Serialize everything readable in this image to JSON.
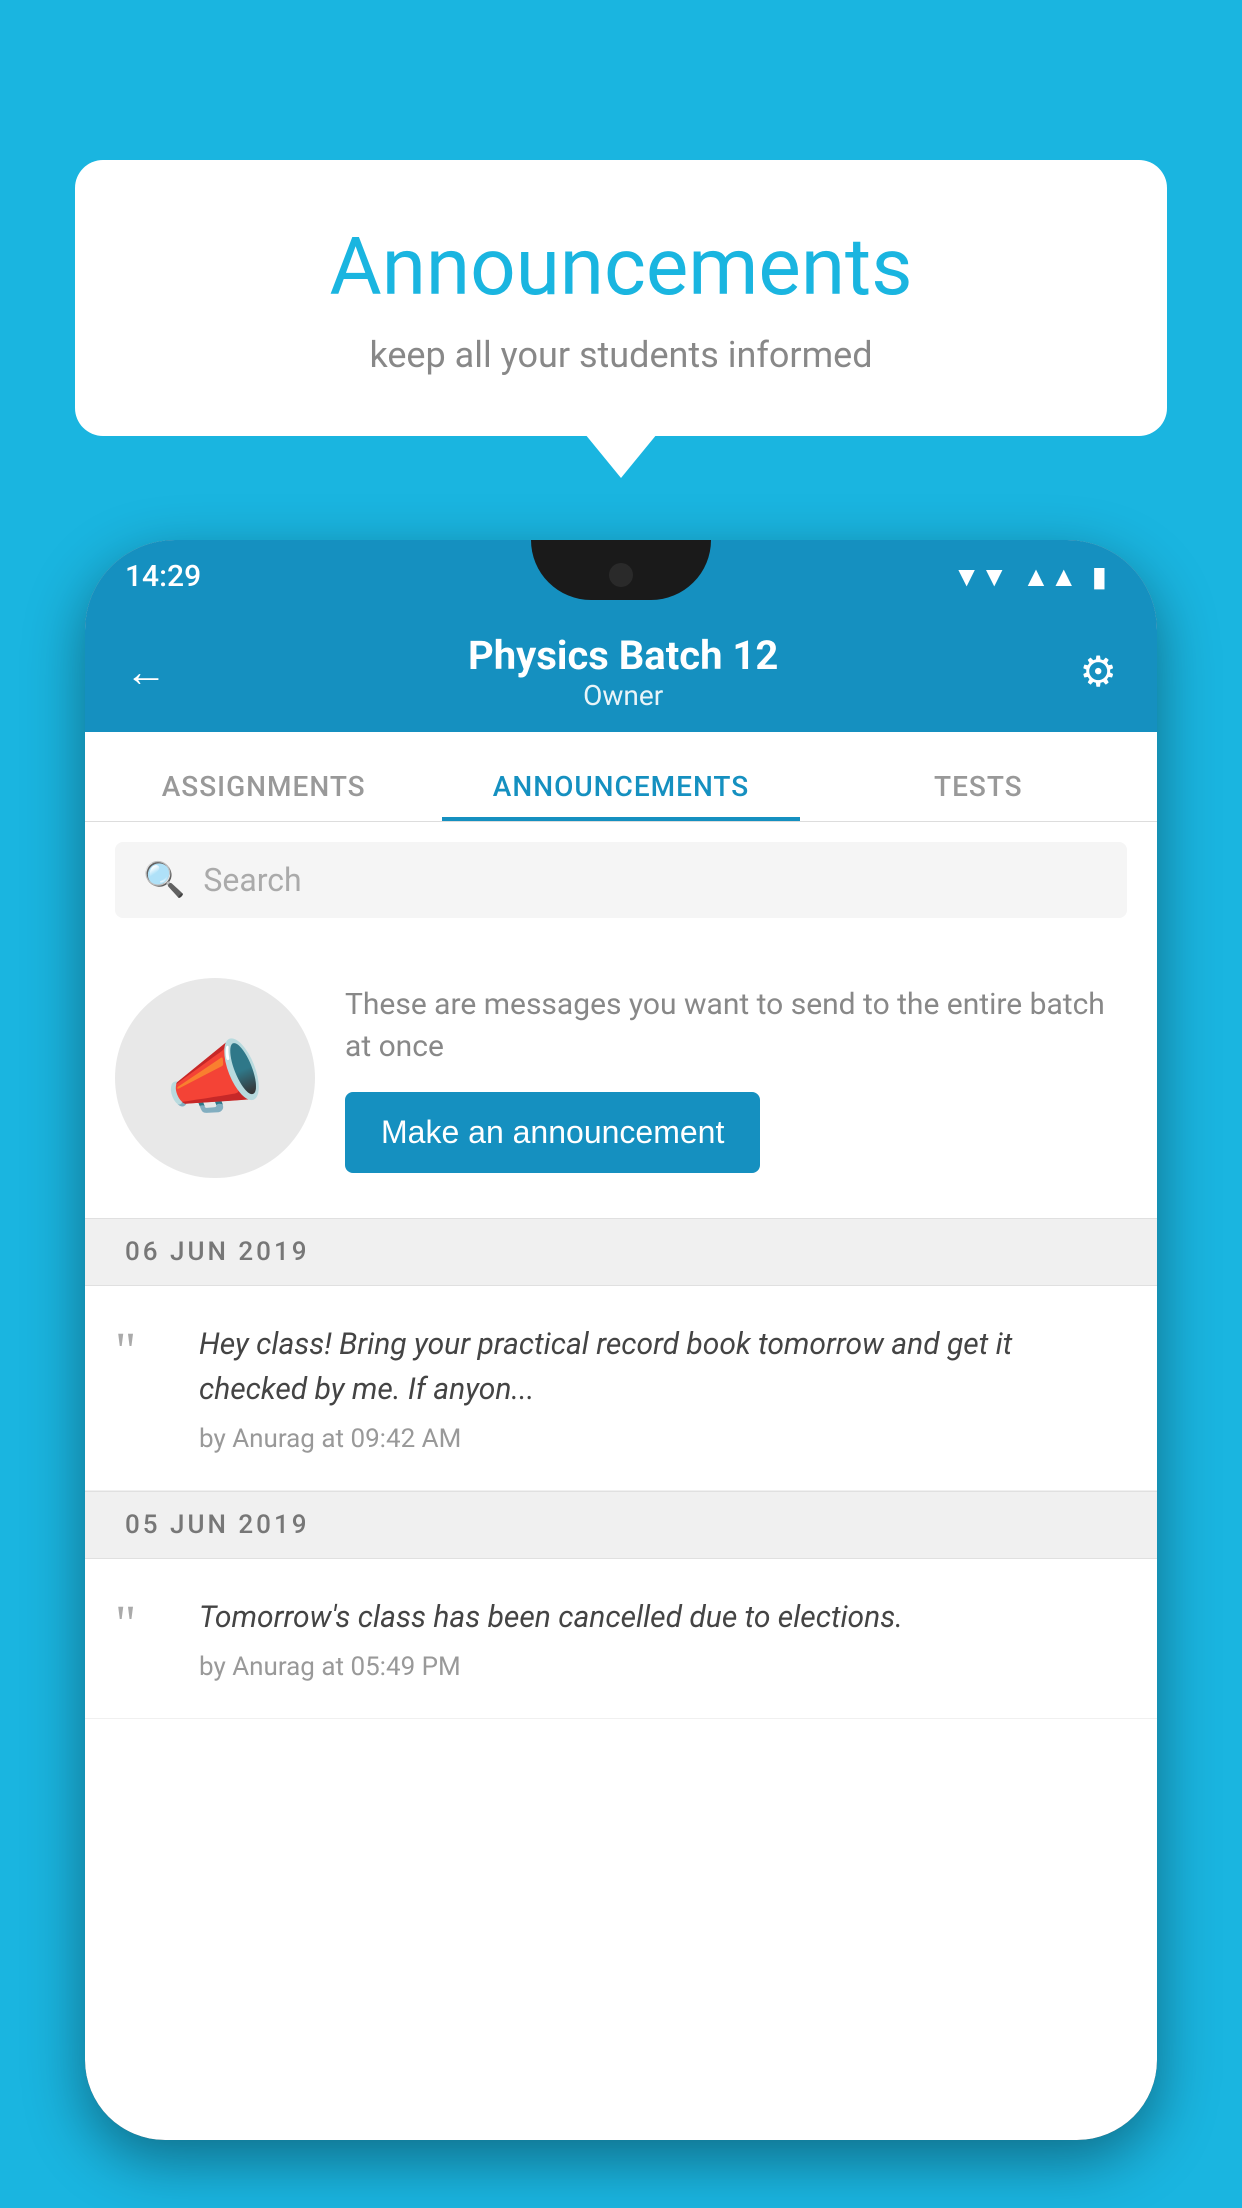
{
  "background_color": "#1ab5e0",
  "speech_bubble": {
    "title": "Announcements",
    "subtitle": "keep all your students informed"
  },
  "phone": {
    "status_bar": {
      "time": "14:29",
      "wifi": "▼",
      "signal": "◀",
      "battery": "▮"
    },
    "app_bar": {
      "title": "Physics Batch 12",
      "subtitle": "Owner",
      "back_label": "←",
      "settings_label": "⚙"
    },
    "tabs": [
      {
        "label": "ASSIGNMENTS",
        "active": false
      },
      {
        "label": "ANNOUNCEMENTS",
        "active": true
      },
      {
        "label": "TESTS",
        "active": false
      }
    ],
    "search": {
      "placeholder": "Search"
    },
    "promo": {
      "description": "These are messages you want to send to the entire batch at once",
      "button_label": "Make an announcement"
    },
    "announcements": [
      {
        "date": "06  JUN  2019",
        "text": "Hey class! Bring your practical record book tomorrow and get it checked by me. If anyon...",
        "meta": "by Anurag at 09:42 AM"
      },
      {
        "date": "05  JUN  2019",
        "text": "Tomorrow's class has been cancelled due to elections.",
        "meta": "by Anurag at 05:49 PM"
      }
    ]
  }
}
